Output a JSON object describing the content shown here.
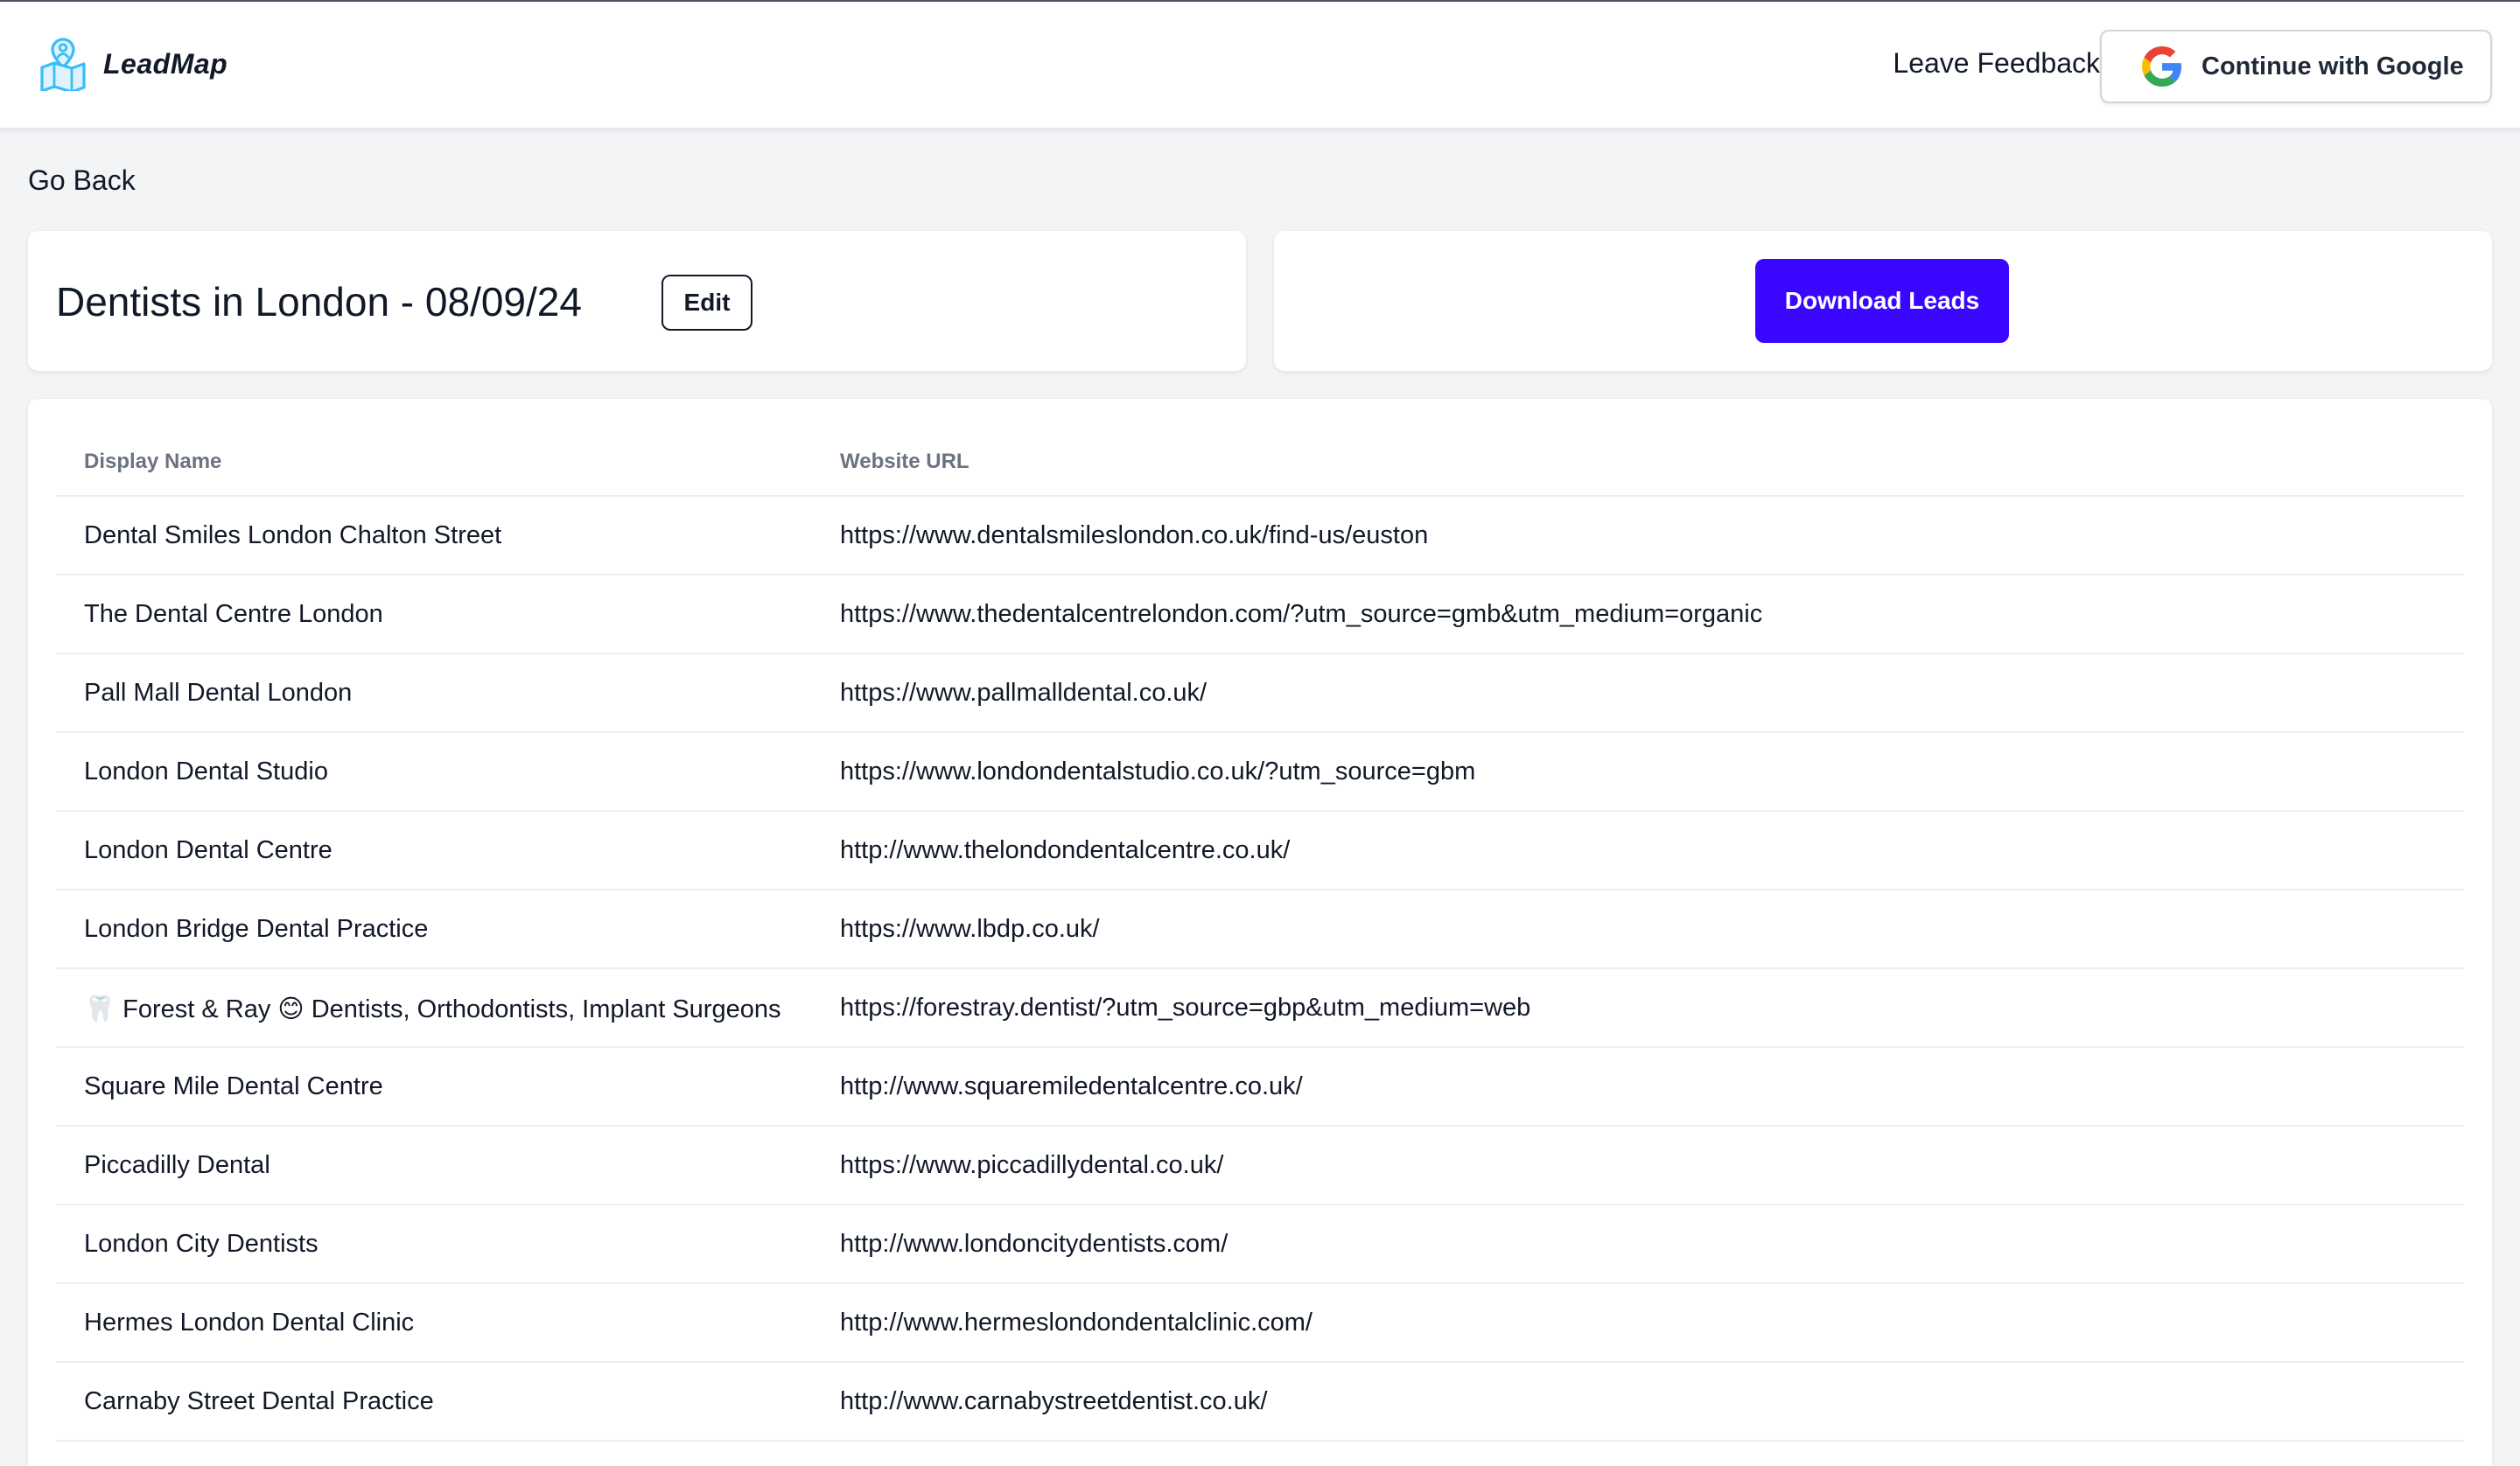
{
  "header": {
    "logo_text": "LeadMap",
    "feedback_label": "Leave Feedback",
    "google_button_label": "Continue with Google"
  },
  "nav": {
    "go_back_label": "Go Back"
  },
  "page": {
    "title": "Dentists in London - 08/09/24",
    "edit_label": "Edit",
    "download_label": "Download Leads"
  },
  "colors": {
    "primary": "#3a06ff",
    "background": "#f3f4f6",
    "card": "#ffffff",
    "header_text": "#6b7280"
  },
  "icons": {
    "logo": "map-pin-person-icon",
    "google": "google-g-icon"
  },
  "table": {
    "headers": [
      "Display Name",
      "Website URL"
    ],
    "rows": [
      {
        "name": "Dental Smiles London Chalton Street",
        "url": "https://www.dentalsmileslondon.co.uk/find-us/euston"
      },
      {
        "name": "The Dental Centre London",
        "url": "https://www.thedentalcentrelondon.com/?utm_source=gmb&utm_medium=organic"
      },
      {
        "name": "Pall Mall Dental London",
        "url": "https://www.pallmalldental.co.uk/"
      },
      {
        "name": "London Dental Studio",
        "url": "https://www.londondentalstudio.co.uk/?utm_source=gbm"
      },
      {
        "name": "London Dental Centre",
        "url": "http://www.thelondondentalcentre.co.uk/"
      },
      {
        "name": "London Bridge Dental Practice",
        "url": "https://www.lbdp.co.uk/"
      },
      {
        "name": "🦷 Forest & Ray 😊 Dentists, Orthodontists, Implant Surgeons",
        "url": "https://forestray.dentist/?utm_source=gbp&utm_medium=web"
      },
      {
        "name": "Square Mile Dental Centre",
        "url": "http://www.squaremiledentalcentre.co.uk/"
      },
      {
        "name": "Piccadilly Dental",
        "url": "https://www.piccadillydental.co.uk/"
      },
      {
        "name": "London City Dentists",
        "url": "http://www.londoncitydentists.com/"
      },
      {
        "name": "Hermes London Dental Clinic",
        "url": "http://www.hermeslondondentalclinic.com/"
      },
      {
        "name": "Carnaby Street Dental Practice",
        "url": "http://www.carnabystreetdentist.co.uk/"
      }
    ]
  }
}
